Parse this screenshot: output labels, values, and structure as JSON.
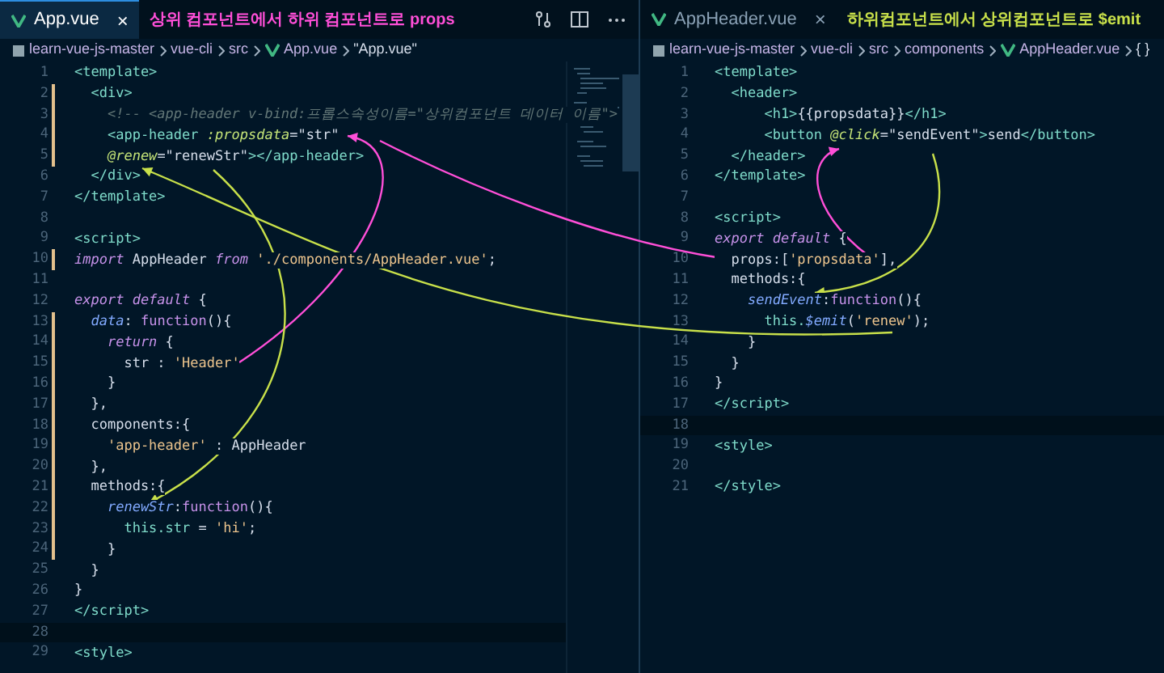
{
  "panes": [
    {
      "tab": {
        "label": "App.vue",
        "selected": true,
        "close": "×"
      },
      "annotation": {
        "text": "상위 컴포넌트에서 하위 컴포넌트로 props",
        "color": "#ff4fd8"
      },
      "breadcrumbs": [
        {
          "text": "learn-vue-js-master",
          "kind": "root"
        },
        {
          "text": "vue-cli",
          "kind": "dir"
        },
        {
          "text": "src",
          "kind": "dir"
        },
        {
          "text": "App.vue",
          "kind": "vue"
        },
        {
          "text": "\"App.vue\"",
          "kind": "symbol"
        }
      ],
      "toolbar": true,
      "minimap": true,
      "lines": [
        {
          "n": "1",
          "modified": false,
          "current": false,
          "tokens": [
            {
              "text": "<template>",
              "kind": "tag"
            }
          ]
        },
        {
          "n": "2",
          "modified": true,
          "current": false,
          "tokens": [
            {
              "text": "  <div>",
              "kind": "tag"
            }
          ]
        },
        {
          "n": "3",
          "modified": true,
          "current": false,
          "tokens": [
            {
              "text": "    <!-- <app-header v-bind:프롭스속성이름=\"상위컴포넌트 데이터 이름\">",
              "kind": "comment"
            }
          ]
        },
        {
          "n": "4",
          "modified": true,
          "current": false,
          "tokens": [
            {
              "text": "    <app-header ",
              "kind": "tag"
            },
            {
              "text": ":propsdata",
              "kind": "attr"
            },
            {
              "text": "=\"str\"",
              "kind": "plain"
            }
          ]
        },
        {
          "n": "5",
          "modified": true,
          "current": false,
          "tokens": [
            {
              "text": "    @renew",
              "kind": "attr"
            },
            {
              "text": "=\"renewStr\"",
              "kind": "plain"
            },
            {
              "text": "></app-header>",
              "kind": "tag"
            }
          ]
        },
        {
          "n": "6",
          "modified": false,
          "current": false,
          "tokens": [
            {
              "text": "  </div>",
              "kind": "tag"
            }
          ]
        },
        {
          "n": "7",
          "modified": false,
          "current": false,
          "tokens": [
            {
              "text": "</template>",
              "kind": "tag"
            }
          ]
        },
        {
          "n": "8",
          "modified": false,
          "current": false
        },
        {
          "n": "9",
          "modified": false,
          "current": false,
          "tokens": [
            {
              "text": "<script>",
              "kind": "tag"
            }
          ]
        },
        {
          "n": "10",
          "modified": true,
          "current": false,
          "tokens": [
            {
              "text": "import",
              "kind": "keyword"
            },
            {
              "text": " AppHeader ",
              "kind": "plain"
            },
            {
              "text": "from",
              "kind": "keyword"
            },
            {
              "text": " './components/AppHeader.vue'",
              "kind": "str"
            },
            {
              "text": ";",
              "kind": "plain"
            }
          ]
        },
        {
          "n": "11",
          "modified": false,
          "current": false
        },
        {
          "n": "12",
          "modified": false,
          "current": false,
          "tokens": [
            {
              "text": "export default",
              "kind": "keyword"
            },
            {
              "text": " {",
              "kind": "plain"
            }
          ]
        },
        {
          "n": "13",
          "modified": true,
          "current": false,
          "tokens": [
            {
              "text": "  data",
              "kind": "prop"
            },
            {
              "text": ": ",
              "kind": "plain"
            },
            {
              "text": "function",
              "kind": "fn"
            },
            {
              "text": "(){",
              "kind": "plain"
            }
          ]
        },
        {
          "n": "14",
          "modified": true,
          "current": false,
          "tokens": [
            {
              "text": "    return",
              "kind": "keyword"
            },
            {
              "text": " {",
              "kind": "plain"
            }
          ]
        },
        {
          "n": "15",
          "modified": true,
          "current": false,
          "tokens": [
            {
              "text": "      str : ",
              "kind": "plain"
            },
            {
              "text": "'Header'",
              "kind": "str"
            }
          ]
        },
        {
          "n": "16",
          "modified": true,
          "current": false,
          "tokens": [
            {
              "text": "    }",
              "kind": "plain"
            }
          ]
        },
        {
          "n": "17",
          "modified": true,
          "current": false,
          "tokens": [
            {
              "text": "  },",
              "kind": "plain"
            }
          ]
        },
        {
          "n": "18",
          "modified": true,
          "current": false,
          "tokens": [
            {
              "text": "  components:{",
              "kind": "plain"
            }
          ]
        },
        {
          "n": "19",
          "modified": true,
          "current": false,
          "tokens": [
            {
              "text": "    'app-header'",
              "kind": "str"
            },
            {
              "text": " : AppHeader",
              "kind": "plain"
            }
          ]
        },
        {
          "n": "20",
          "modified": true,
          "current": false,
          "tokens": [
            {
              "text": "  },",
              "kind": "plain"
            }
          ]
        },
        {
          "n": "21",
          "modified": true,
          "current": false,
          "tokens": [
            {
              "text": "  methods:{",
              "kind": "plain"
            }
          ]
        },
        {
          "n": "22",
          "modified": true,
          "current": false,
          "tokens": [
            {
              "text": "    renewStr",
              "kind": "prop"
            },
            {
              "text": ":",
              "kind": "plain"
            },
            {
              "text": "function",
              "kind": "fn"
            },
            {
              "text": "(){",
              "kind": "plain"
            }
          ]
        },
        {
          "n": "23",
          "modified": true,
          "current": false,
          "tokens": [
            {
              "text": "      this.str",
              "kind": "this"
            },
            {
              "text": " = ",
              "kind": "plain"
            },
            {
              "text": "'hi'",
              "kind": "str"
            },
            {
              "text": ";",
              "kind": "plain"
            }
          ]
        },
        {
          "n": "24",
          "modified": true,
          "current": false,
          "tokens": [
            {
              "text": "    }",
              "kind": "plain"
            }
          ]
        },
        {
          "n": "25",
          "modified": false,
          "current": false,
          "tokens": [
            {
              "text": "  }",
              "kind": "plain"
            }
          ]
        },
        {
          "n": "26",
          "modified": false,
          "current": false,
          "tokens": [
            {
              "text": "}",
              "kind": "plain"
            }
          ]
        },
        {
          "n": "27",
          "modified": false,
          "current": false,
          "tokens": [
            {
              "text": "</script>",
              "kind": "tag"
            }
          ]
        },
        {
          "n": "28",
          "modified": false,
          "current": true
        },
        {
          "n": "29",
          "modified": false,
          "current": false,
          "tokens": [
            {
              "text": "<style>",
              "kind": "tag"
            }
          ]
        }
      ]
    },
    {
      "tab": {
        "label": "AppHeader.vue",
        "selected": false,
        "close": "×"
      },
      "annotation": {
        "text": "하위컴포넌트에서 상위컴포넌트로 $emit",
        "color": "#c8e04a"
      },
      "breadcrumbs": [
        {
          "text": "learn-vue-js-master",
          "kind": "root"
        },
        {
          "text": "vue-cli",
          "kind": "dir"
        },
        {
          "text": "src",
          "kind": "dir"
        },
        {
          "text": "components",
          "kind": "dir"
        },
        {
          "text": "AppHeader.vue",
          "kind": "vue"
        },
        {
          "text": "{ }",
          "kind": "symbol"
        }
      ],
      "toolbar": false,
      "minimap": false,
      "lines": [
        {
          "n": "1",
          "modified": false,
          "current": false,
          "tokens": [
            {
              "text": "<template>",
              "kind": "tag"
            }
          ]
        },
        {
          "n": "2",
          "modified": false,
          "current": false,
          "tokens": [
            {
              "text": "  <header>",
              "kind": "tag"
            }
          ]
        },
        {
          "n": "3",
          "modified": false,
          "current": false,
          "tokens": [
            {
              "text": "      <h1>",
              "kind": "tag"
            },
            {
              "text": "{{propsdata}}",
              "kind": "plain"
            },
            {
              "text": "</h1>",
              "kind": "tag"
            }
          ]
        },
        {
          "n": "4",
          "modified": false,
          "current": false,
          "tokens": [
            {
              "text": "      <button ",
              "kind": "tag"
            },
            {
              "text": "@click",
              "kind": "attr"
            },
            {
              "text": "=\"sendEvent\"",
              "kind": "plain"
            },
            {
              "text": ">",
              "kind": "tag"
            },
            {
              "text": "send",
              "kind": "plain"
            },
            {
              "text": "</button>",
              "kind": "tag"
            }
          ]
        },
        {
          "n": "5",
          "modified": false,
          "current": false,
          "tokens": [
            {
              "text": "  </header>",
              "kind": "tag"
            }
          ]
        },
        {
          "n": "6",
          "modified": false,
          "current": false,
          "tokens": [
            {
              "text": "</template>",
              "kind": "tag"
            }
          ]
        },
        {
          "n": "7",
          "modified": false,
          "current": false
        },
        {
          "n": "8",
          "modified": false,
          "current": false,
          "tokens": [
            {
              "text": "<script>",
              "kind": "tag"
            }
          ]
        },
        {
          "n": "9",
          "modified": false,
          "current": false,
          "tokens": [
            {
              "text": "export default",
              "kind": "keyword"
            },
            {
              "text": " {",
              "kind": "plain"
            }
          ]
        },
        {
          "n": "10",
          "modified": false,
          "current": false,
          "tokens": [
            {
              "text": "  props:[",
              "kind": "plain"
            },
            {
              "text": "'propsdata'",
              "kind": "str"
            },
            {
              "text": "],",
              "kind": "plain"
            }
          ]
        },
        {
          "n": "11",
          "modified": false,
          "current": false,
          "tokens": [
            {
              "text": "  methods:{",
              "kind": "plain"
            }
          ]
        },
        {
          "n": "12",
          "modified": false,
          "current": false,
          "tokens": [
            {
              "text": "    sendEvent",
              "kind": "prop"
            },
            {
              "text": ":",
              "kind": "plain"
            },
            {
              "text": "function",
              "kind": "fn"
            },
            {
              "text": "(){",
              "kind": "plain"
            }
          ]
        },
        {
          "n": "13",
          "modified": false,
          "current": false,
          "tokens": [
            {
              "text": "      this.",
              "kind": "this"
            },
            {
              "text": "$emit",
              "kind": "prop"
            },
            {
              "text": "(",
              "kind": "plain"
            },
            {
              "text": "'renew'",
              "kind": "str"
            },
            {
              "text": ");",
              "kind": "plain"
            }
          ]
        },
        {
          "n": "14",
          "modified": false,
          "current": false,
          "tokens": [
            {
              "text": "    }",
              "kind": "plain"
            }
          ]
        },
        {
          "n": "15",
          "modified": false,
          "current": false,
          "tokens": [
            {
              "text": "  }",
              "kind": "plain"
            }
          ]
        },
        {
          "n": "16",
          "modified": false,
          "current": false,
          "tokens": [
            {
              "text": "}",
              "kind": "plain"
            }
          ]
        },
        {
          "n": "17",
          "modified": false,
          "current": false,
          "tokens": [
            {
              "text": "</script>",
              "kind": "tag"
            }
          ]
        },
        {
          "n": "18",
          "modified": false,
          "current": true
        },
        {
          "n": "19",
          "modified": false,
          "current": false,
          "tokens": [
            {
              "text": "<style>",
              "kind": "tag"
            }
          ]
        },
        {
          "n": "20",
          "modified": false,
          "current": false
        },
        {
          "n": "21",
          "modified": false,
          "current": false,
          "tokens": [
            {
              "text": "</style>",
              "kind": "tag"
            }
          ]
        }
      ]
    }
  ]
}
